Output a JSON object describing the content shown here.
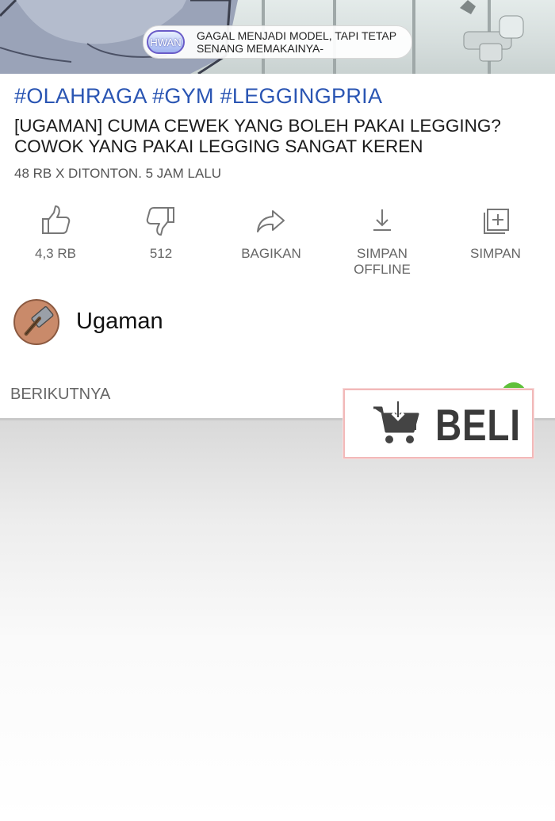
{
  "video": {
    "caption_badge": "HWAN",
    "caption_text": "GAGAL MENJADI MODEL, TAPI TETAP SENANG MEMAKAINYA-"
  },
  "tags": "#OLAHRAGA #GYM #LEGGINGPRIA",
  "title": "[UGAMAN] CUMA CEWEK YANG BOLEH PAKAI LEGGING? COWOK YANG PAKAI LEGGING SANGAT KEREN",
  "meta": "48 RB X DITONTON. 5 JAM LALU",
  "actions": {
    "like": {
      "label": "4,3 RB",
      "icon": "thumbs-up-icon"
    },
    "dislike": {
      "label": "512",
      "icon": "thumbs-down-icon"
    },
    "share": {
      "label": "BAGIKAN",
      "icon": "share-icon"
    },
    "offline": {
      "label": "SIMPAN OFFLINE",
      "icon": "download-icon"
    },
    "save": {
      "label": "SIMPAN",
      "icon": "add-to-playlist-icon"
    }
  },
  "channel": {
    "name": "Ugaman",
    "avatar_icon": "hammer-icon"
  },
  "next": {
    "label": "BERIKUTNYA"
  },
  "buy": {
    "label": "BELI",
    "icon": "cart-download-icon"
  },
  "colors": {
    "tags": "#2a55b3",
    "toggle": "#5fc03a",
    "buy_border": "#f2b9b9"
  }
}
